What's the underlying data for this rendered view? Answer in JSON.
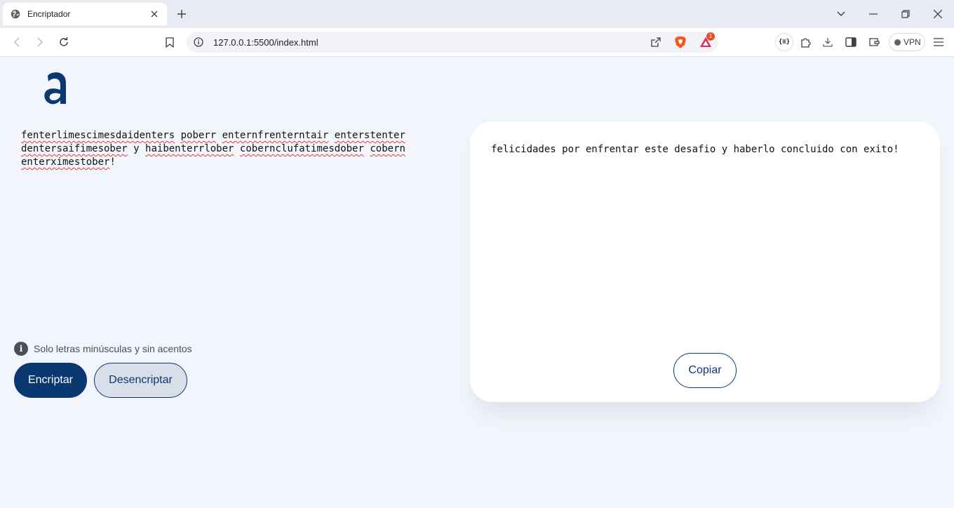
{
  "browser": {
    "tab_title": "Encriptador",
    "url": "127.0.0.1:5500/index.html",
    "notification_count": "1",
    "vpn_label": "VPN",
    "braces_label": "{≡}"
  },
  "page": {
    "input_words": [
      "fenterlimescimesdaidenters",
      "poberr",
      "enternfrenterntair",
      "enterstenter",
      "dentersaifimesober",
      "y",
      "haibenterrlober",
      "cobernclufatimesdober",
      "cobern",
      "enterximestober"
    ],
    "input_trailing": "!",
    "hint_text": "Solo letras minúsculas y sin acentos",
    "encrypt_label": "Encriptar",
    "decrypt_label": "Desencriptar",
    "output_text": "felicidades por enfrentar este desafio y haberlo concluido con exito!",
    "copy_label": "Copiar"
  },
  "colors": {
    "accent": "#0a3871",
    "background": "#f3f5fc",
    "card": "#ffffff"
  }
}
